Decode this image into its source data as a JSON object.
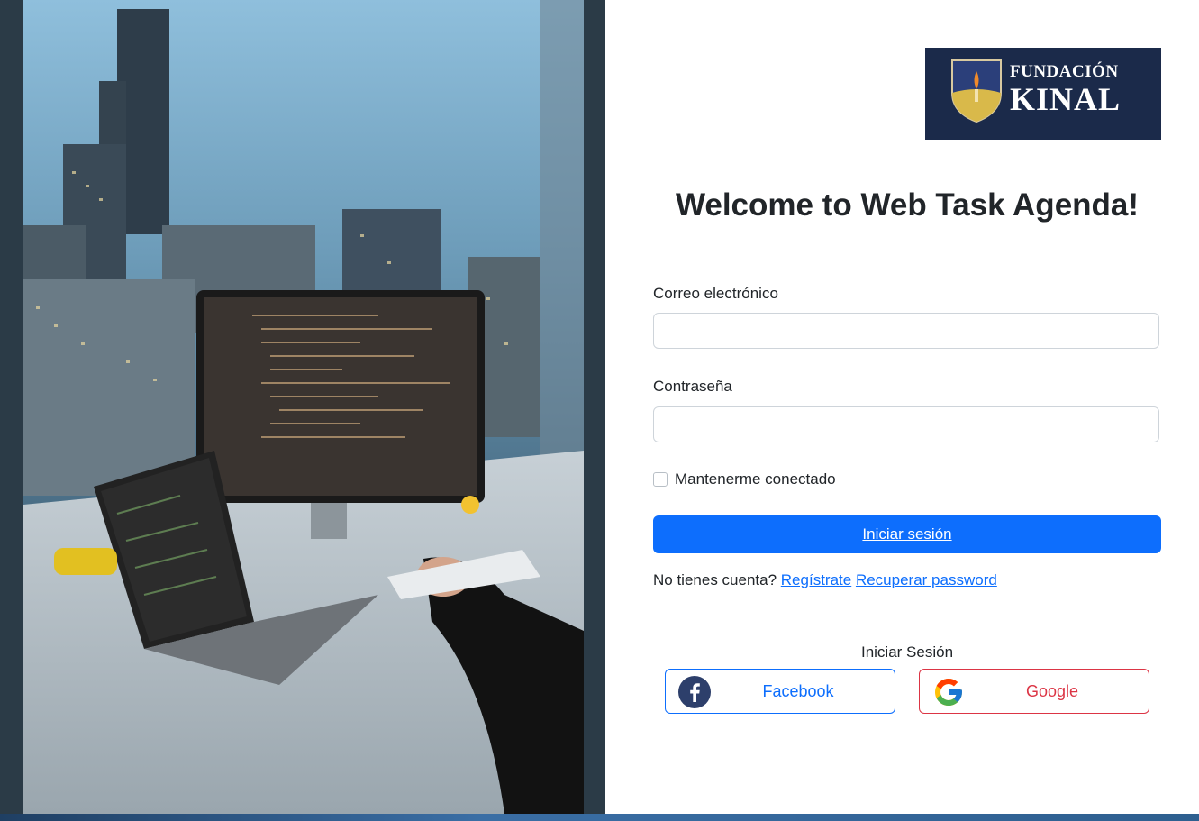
{
  "photo": {
    "icon": "city-desk-photo"
  },
  "logo": {
    "line1": "FUNDACIÓN",
    "line2": "KINAL"
  },
  "form": {
    "title": "Welcome to Web Task Agenda!",
    "email_label": "Correo electrónico",
    "email_value": "",
    "password_label": "Contraseña",
    "password_value": "",
    "remember_label": "Mantenerme conectado",
    "remember_checked": false,
    "submit_label": "Iniciar sesión",
    "no_account_text": "No tienes cuenta?",
    "register_link": "Regístrate",
    "recover_link": "Recuperar password"
  },
  "social": {
    "title": "Iniciar Sesión",
    "facebook_label": "Facebook",
    "google_label": "Google"
  },
  "colors": {
    "primary": "#0d6efd",
    "danger": "#dc3545",
    "logo_bg": "#1b2a4a"
  }
}
